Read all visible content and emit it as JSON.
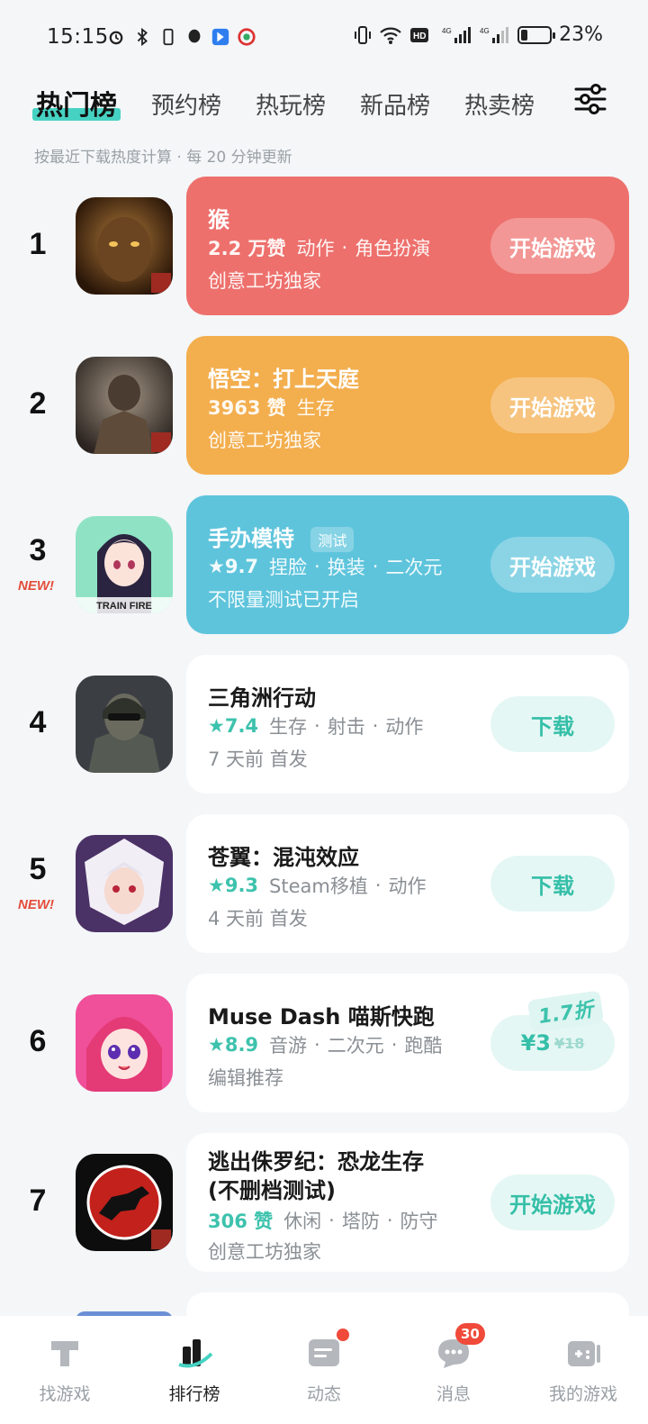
{
  "status_bar": {
    "time": "15:15",
    "battery": "23%",
    "battery_level": 0.23
  },
  "tabs": [
    {
      "label": "热门榜",
      "active": true
    },
    {
      "label": "预约榜",
      "active": false
    },
    {
      "label": "热玩榜",
      "active": false
    },
    {
      "label": "新品榜",
      "active": false
    },
    {
      "label": "热卖榜",
      "active": false
    }
  ],
  "subtitle": "按最近下载热度计算 · 每 20 分钟更新",
  "games": [
    {
      "rank": "1",
      "new": "",
      "title": "猴",
      "test_badge": "",
      "score": "2.2 万赞",
      "tags": [
        "动作",
        "角色扮演"
      ],
      "sub": "创意工坊独家",
      "button": "开始游戏",
      "card_color": "#ed706c",
      "thumb_icon": "wukong-thumbnail"
    },
    {
      "rank": "2",
      "new": "",
      "title": "悟空：打上天庭",
      "test_badge": "",
      "score": "3963 赞",
      "tags": [
        "生存"
      ],
      "sub": "创意工坊独家",
      "button": "开始游戏",
      "card_color": "#f3ae4e",
      "thumb_icon": "wukong-armor-thumbnail"
    },
    {
      "rank": "3",
      "new": "NEW!",
      "title": "手办模特",
      "test_badge": "测试",
      "score": "★9.7",
      "tags": [
        "捏脸",
        "换装",
        "二次元"
      ],
      "sub": "不限量测试已开启",
      "button": "开始游戏",
      "card_color": "#5ec4dc",
      "thumb_icon": "anime-girl-thumbnail",
      "thumb_caption": "TRAIN FIRE"
    },
    {
      "rank": "4",
      "new": "",
      "title": "三角洲行动",
      "test_badge": "",
      "score": "★7.4",
      "tags": [
        "生存",
        "射击",
        "动作"
      ],
      "sub": "7 天前 首发",
      "button": "下载",
      "card_color": "#ffffff",
      "thumb_icon": "soldier-thumbnail"
    },
    {
      "rank": "5",
      "new": "NEW!",
      "title": "苍翼：混沌效应",
      "test_badge": "",
      "score": "★9.3",
      "tags": [
        "Steam移植",
        "动作"
      ],
      "sub": "4 天前 首发",
      "button": "下载",
      "card_color": "#ffffff",
      "thumb_icon": "white-hair-hero-thumbnail"
    },
    {
      "rank": "6",
      "new": "",
      "title": "Muse Dash 喵斯快跑",
      "test_badge": "",
      "score": "★8.9",
      "tags": [
        "音游",
        "二次元",
        "跑酷"
      ],
      "sub": "编辑推荐",
      "button": "",
      "price": "¥3",
      "price_old": "¥18",
      "discount": "1.7折",
      "card_color": "#ffffff",
      "thumb_icon": "pink-hair-girl-thumbnail"
    },
    {
      "rank": "7",
      "new": "",
      "title": "逃出侏罗纪：恐龙生存",
      "title2": "(不删档测试)",
      "test_badge": "",
      "score": "306 赞",
      "tags": [
        "休闲",
        "塔防",
        "防守"
      ],
      "sub": "创意工坊独家",
      "button": "开始游戏",
      "card_color": "#ffffff",
      "thumb_icon": "dinosaur-logo-thumbnail"
    }
  ],
  "bottom_nav": [
    {
      "label": "找游戏",
      "icon": "find-games-icon",
      "active": false
    },
    {
      "label": "排行榜",
      "icon": "ranking-icon",
      "active": true
    },
    {
      "label": "动态",
      "icon": "feed-icon",
      "active": false,
      "dot": true
    },
    {
      "label": "消息",
      "icon": "message-icon",
      "active": false,
      "badge": "30"
    },
    {
      "label": "我的游戏",
      "icon": "my-games-icon",
      "active": false
    }
  ]
}
